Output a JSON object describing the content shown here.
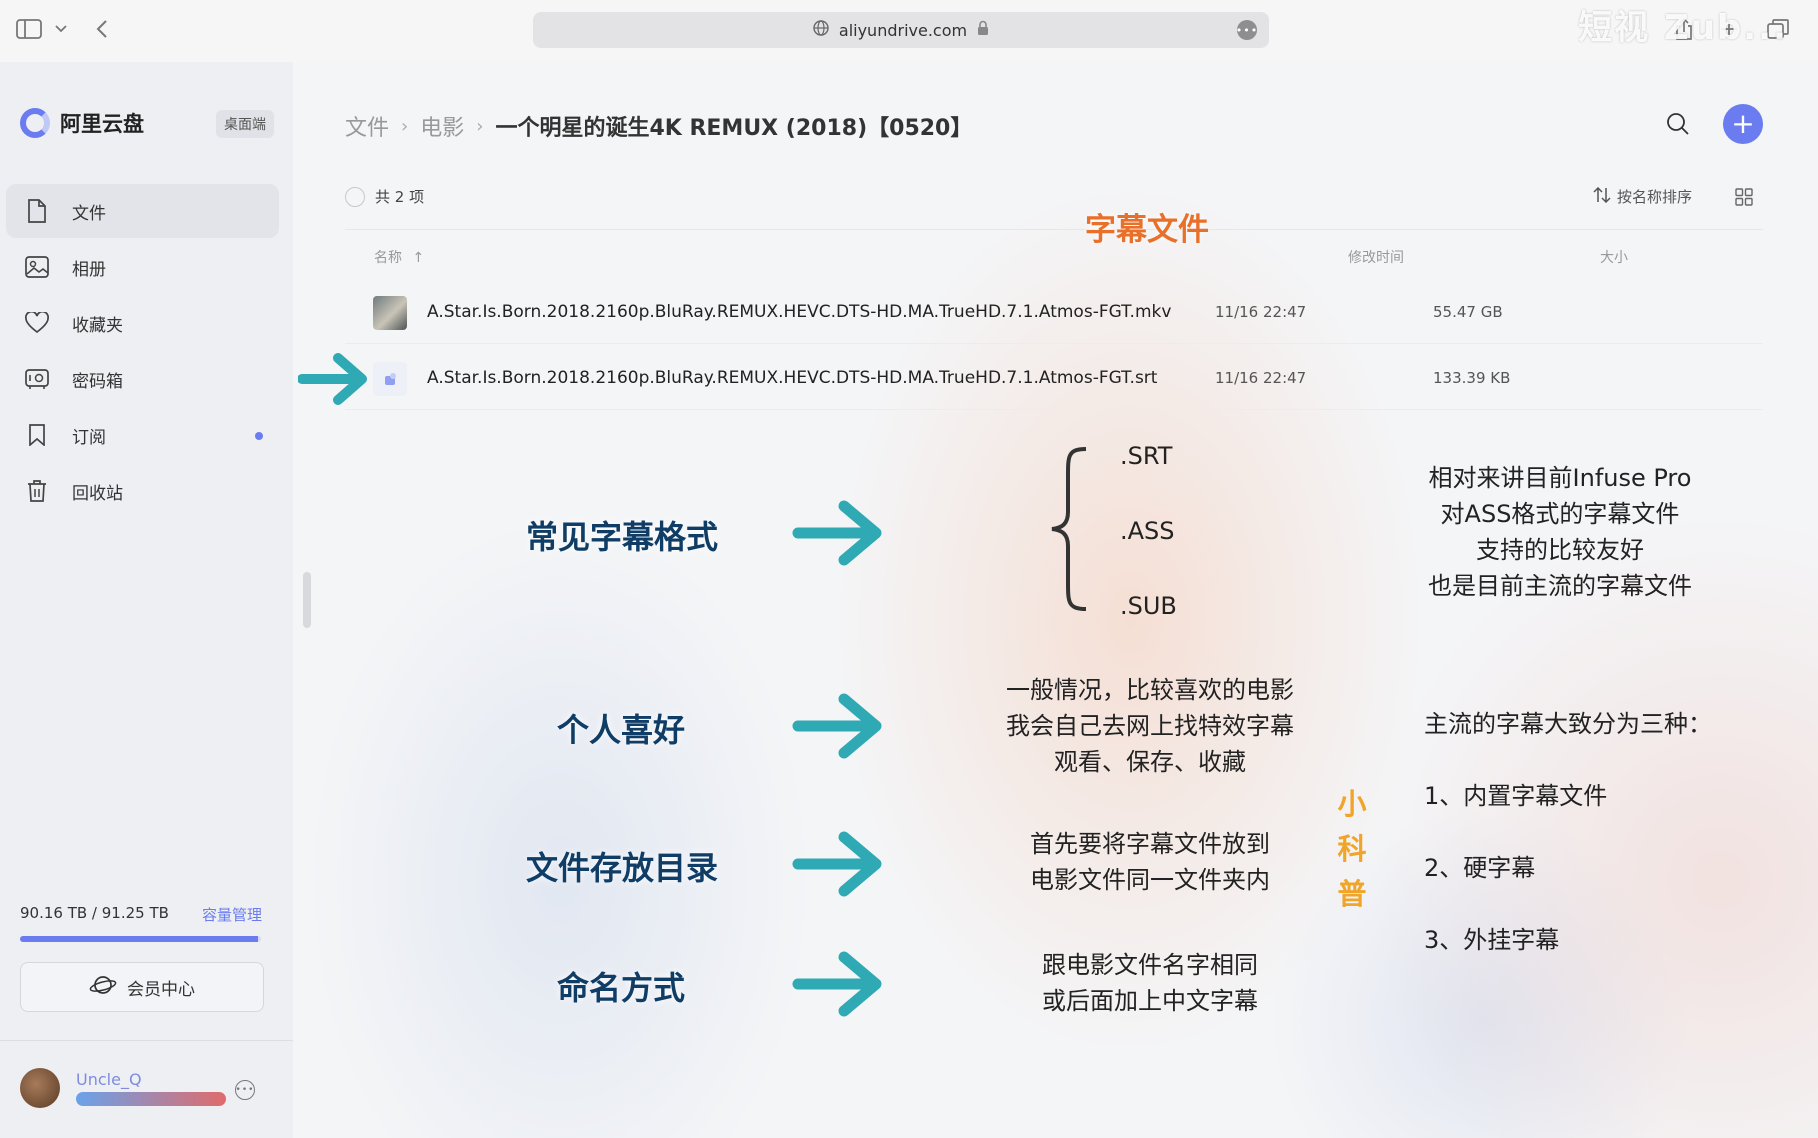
{
  "browser": {
    "url": "aliyundrive.com",
    "watermark": "短视 Zub..."
  },
  "sidebar": {
    "app_name": "阿里云盘",
    "badge": "桌面端",
    "items": [
      {
        "label": "文件",
        "icon": "file-icon",
        "active": true
      },
      {
        "label": "相册",
        "icon": "album-icon"
      },
      {
        "label": "收藏夹",
        "icon": "heart-icon"
      },
      {
        "label": "密码箱",
        "icon": "safe-icon"
      },
      {
        "label": "订阅",
        "icon": "bookmark-icon",
        "dot": true
      },
      {
        "label": "回收站",
        "icon": "trash-icon"
      }
    ],
    "storage": {
      "text": "90.16 TB / 91.25 TB",
      "manage": "容量管理",
      "used_fraction": 0.988
    },
    "member_button": "会员中心",
    "user": {
      "name": "Uncle_Q"
    }
  },
  "main": {
    "breadcrumb": [
      "文件",
      "电影",
      "一个明星的诞生4K REMUX (2018)【0520】"
    ],
    "count": "共 2 项",
    "sort": "按名称排序",
    "columns": {
      "name": "名称",
      "modified": "修改时间",
      "size": "大小"
    },
    "files": [
      {
        "name": "A.Star.Is.Born.2018.2160p.BluRay.REMUX.HEVC.DTS-HD.MA.TrueHD.7.1.Atmos-FGT.mkv",
        "date": "11/16 22:47",
        "size": "55.47 GB",
        "type": "video"
      },
      {
        "name": "A.Star.Is.Born.2018.2160p.BluRay.REMUX.HEVC.DTS-HD.MA.TrueHD.7.1.Atmos-FGT.srt",
        "date": "11/16 22:47",
        "size": "133.39 KB",
        "type": "subtitle"
      }
    ]
  },
  "overlay": {
    "title": "字幕文件",
    "labels": {
      "formats": "常见字幕格式",
      "preference": "个人喜好",
      "directory": "文件存放目录",
      "naming": "命名方式"
    },
    "formats": [
      ".SRT",
      ".ASS",
      ".SUB"
    ],
    "infuse_note": [
      "相对来讲目前Infuse Pro",
      "对ASS格式的字幕文件",
      "支持的比较友好",
      "也是目前主流的字幕文件"
    ],
    "preference_note": [
      "一般情况，比较喜欢的电影",
      "我会自己去网上找特效字幕",
      "观看、保存、收藏"
    ],
    "directory_note": [
      "首先要将字幕文件放到",
      "电影文件同一文件夹内"
    ],
    "naming_note": [
      "跟电影文件名字相同",
      "或后面加上中文字幕"
    ],
    "tips_vertical": [
      "小",
      "科",
      "普"
    ],
    "types_title": "主流的字幕大致分为三种：",
    "types": [
      "1、内置字幕文件",
      "2、硬字幕",
      "3、外挂字幕"
    ]
  }
}
